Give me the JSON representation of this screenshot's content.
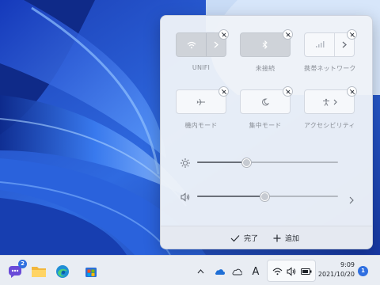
{
  "quick_settings": {
    "tiles": [
      {
        "label": "UNIFI",
        "icon": "wifi-icon",
        "has_arrow": true,
        "state": "on"
      },
      {
        "label": "未接続",
        "icon": "bluetooth-icon",
        "has_arrow": false,
        "state": "on"
      },
      {
        "label": "携帯ネットワーク",
        "icon": "cellular-icon",
        "has_arrow": true,
        "state": "off"
      },
      {
        "label": "機内モード",
        "icon": "airplane-icon",
        "has_arrow": false,
        "state": "off"
      },
      {
        "label": "集中モード",
        "icon": "moon-icon",
        "has_arrow": false,
        "state": "off"
      },
      {
        "label": "アクセシビリティ",
        "icon": "accessibility-icon",
        "has_arrow": true,
        "state": "off"
      }
    ],
    "brightness": {
      "icon": "brightness-icon",
      "level": 0.35
    },
    "volume": {
      "icon": "speaker-icon",
      "level": 0.48
    },
    "footer": {
      "done_label": "完了",
      "add_label": "追加"
    }
  },
  "taskbar": {
    "chat_badge": "2",
    "clock_time": "9:09",
    "clock_date": "2021/10/20",
    "notification_count": "1",
    "ime_indicator": "A"
  },
  "colors": {
    "accent": "#2f6fe0",
    "panel_bg": "#eef2f8",
    "tile_on": "#cfd3d9",
    "wallpaper_blue": "#1e46c8"
  }
}
